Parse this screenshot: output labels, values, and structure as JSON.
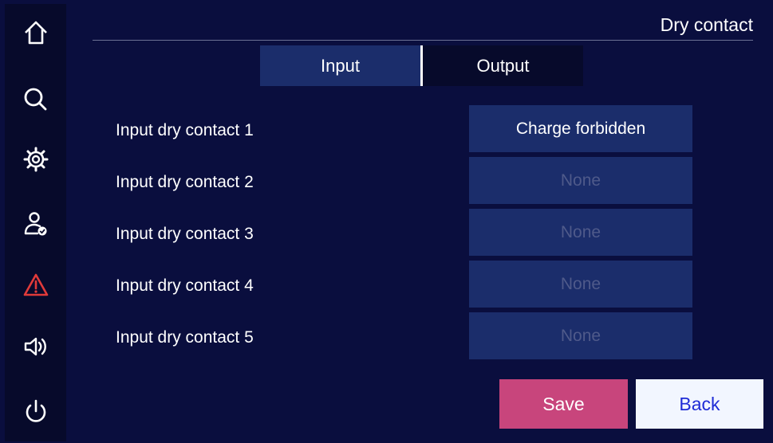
{
  "page": {
    "title": "Dry contact"
  },
  "sidebar": {
    "items": [
      {
        "name": "home-icon",
        "label": "Home"
      },
      {
        "name": "search-icon",
        "label": "Search"
      },
      {
        "name": "gear-icon",
        "label": "Settings"
      },
      {
        "name": "user-check-icon",
        "label": "User"
      },
      {
        "name": "warning-icon",
        "label": "Alarm"
      },
      {
        "name": "speaker-icon",
        "label": "Sound"
      },
      {
        "name": "power-icon",
        "label": "Power"
      }
    ],
    "warning_color": "#e03a3a"
  },
  "tabs": [
    {
      "label": "Input",
      "active": true
    },
    {
      "label": "Output",
      "active": false
    }
  ],
  "rows": [
    {
      "label": "Input dry contact 1",
      "value": "Charge forbidden"
    },
    {
      "label": "Input dry contact 2",
      "value": "None"
    },
    {
      "label": "Input dry contact 3",
      "value": "None"
    },
    {
      "label": "Input dry contact 4",
      "value": "None"
    },
    {
      "label": "Input dry contact 5",
      "value": "None"
    }
  ],
  "actions": {
    "save_label": "Save",
    "back_label": "Back"
  },
  "colors": {
    "background": "#0a0e3e",
    "panel": "#1b2d6b",
    "save": "#c8457c",
    "back": "#f2f6ff"
  }
}
